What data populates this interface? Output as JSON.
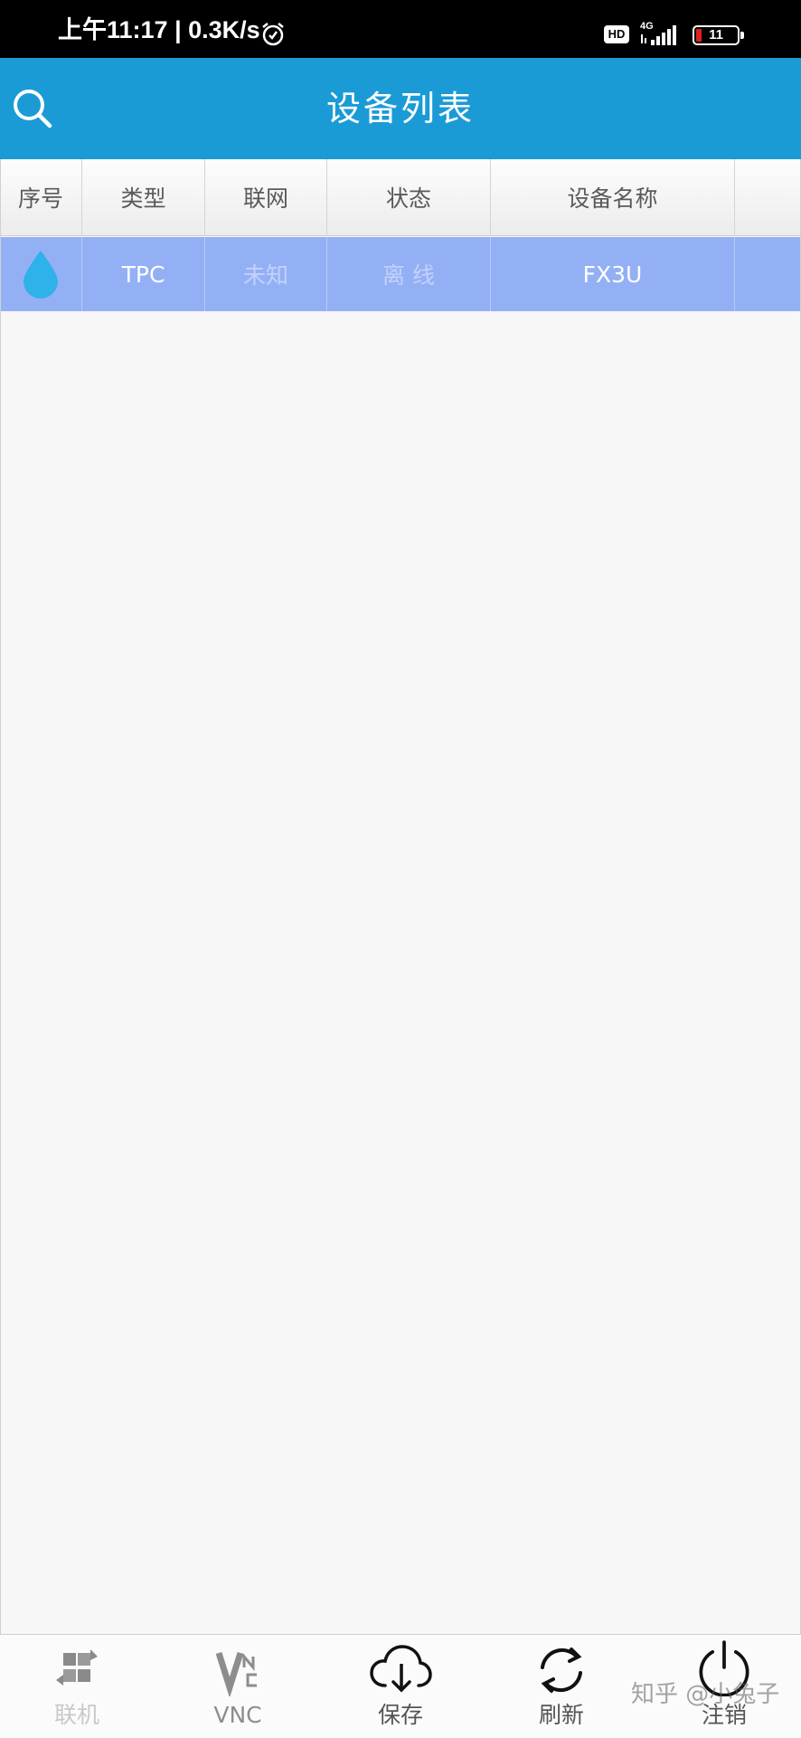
{
  "status_bar": {
    "time_speed": "上午11:17 | 0.3K/s",
    "hd": "HD",
    "network": "4G",
    "battery": "11"
  },
  "header": {
    "title": "设备列表"
  },
  "table": {
    "columns": [
      "序号",
      "类型",
      "联网",
      "状态",
      "设备名称"
    ],
    "rows": [
      {
        "type": "TPC",
        "network": "未知",
        "status": "离 线",
        "name": "FX3U"
      }
    ]
  },
  "bottom_nav": {
    "connect": "联机",
    "vnc": "VNC",
    "save": "保存",
    "refresh": "刷新",
    "logout": "注销"
  },
  "watermark": "知乎 @小兔子",
  "colors": {
    "header_bg": "#1a9bd6",
    "row_selected": "#94b0f5",
    "drop_icon": "#2fb1ea"
  }
}
